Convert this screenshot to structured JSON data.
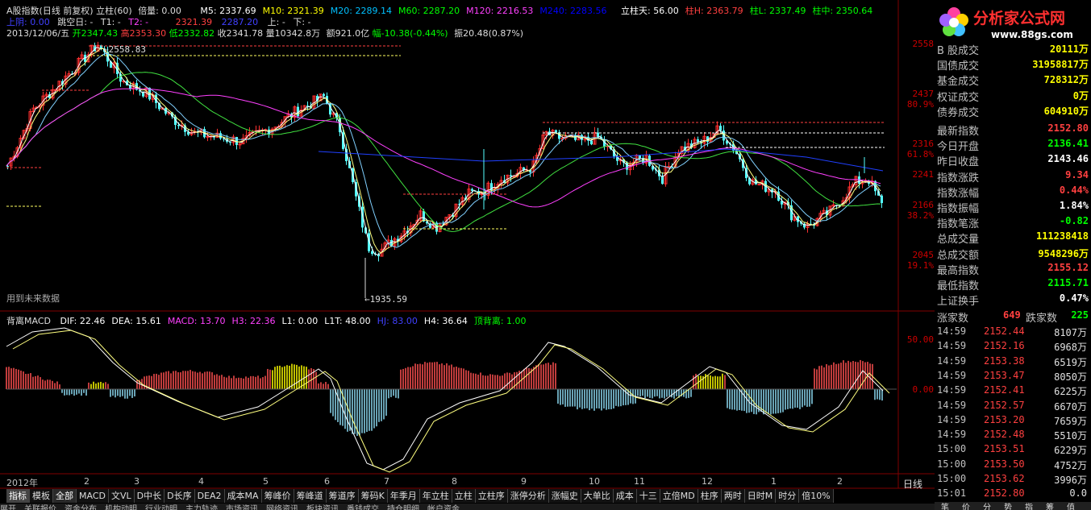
{
  "header": {
    "title": "A股指数(日线 前复权) 立柱(60)",
    "beiliang": "倍量: 0.00",
    "ma": [
      {
        "label": "M5: 2337.69",
        "color": "#ffffff"
      },
      {
        "label": "M10: 2321.39",
        "color": "#ffff00"
      },
      {
        "label": "M20: 2289.14",
        "color": "#00c0ff"
      },
      {
        "label": "M60: 2287.20",
        "color": "#00ff00"
      },
      {
        "label": "M120: 2216.53",
        "color": "#ff40ff"
      },
      {
        "label": "M240: 2283.56",
        "color": "#0000ff"
      }
    ],
    "lizhu": [
      {
        "label": "立柱天: 56.00",
        "color": "#ffffff"
      },
      {
        "label": "柱H: 2363.79",
        "color": "#ff4040"
      },
      {
        "label": "柱L: 2337.49",
        "color": "#00ff00"
      },
      {
        "label": "柱中: 2350.64",
        "color": "#00ff00"
      }
    ],
    "line2": {
      "shangyin": "上阴: 0.00",
      "tiaokong": "跳空日: -",
      "t1": "T1: -",
      "t2": "T2: -",
      "v1": "2321.39",
      "v2": "2287.20",
      "shang": "上: -",
      "xia": "下: -"
    },
    "line3": {
      "date": "2013/12/06/五",
      "kai": "开2347.43",
      "gao": "高2353.30",
      "di": "低2332.82",
      "shou": "收2341.78",
      "liang": "量10342.8万",
      "e": "额921.0亿",
      "fu": "幅-10.38(-0.44%)",
      "zhen": "振20.48(0.87%)"
    }
  },
  "price_panel": {
    "price_axis": [
      {
        "label": "2558",
        "pct": ""
      },
      {
        "label": "2437",
        "pct": "80.9%"
      },
      {
        "label": "2316",
        "pct": "61.8%"
      },
      {
        "label": "2241",
        "pct": ""
      },
      {
        "label": "2166",
        "pct": "38.2%"
      },
      {
        "label": "2045",
        "pct": "19.1%"
      }
    ],
    "high_label": "2558.83",
    "low_label": "1935.59",
    "future_note": "用到未来数据"
  },
  "macd_panel": {
    "title": "背离MACD",
    "items": [
      {
        "label": "DIF: 22.46",
        "color": "#ffffff"
      },
      {
        "label": "DEA: 15.61",
        "color": "#ffffff"
      },
      {
        "label": "MACD: 13.70",
        "color": "#ff40ff"
      },
      {
        "label": "H3: 22.36",
        "color": "#ff40ff"
      },
      {
        "label": "L1: 0.00",
        "color": "#ffffff"
      },
      {
        "label": "L1T: 48.00",
        "color": "#ffffff"
      },
      {
        "label": "HJ: 83.00",
        "color": "#4040ff"
      },
      {
        "label": "H4: 36.64",
        "color": "#ffffff"
      },
      {
        "label": "顶背离: 1.00",
        "color": "#00ff00"
      }
    ],
    "axis": [
      "50.00",
      "0.00"
    ]
  },
  "date_axis": [
    "2012年",
    "2",
    "3",
    "4",
    "5",
    "6",
    "7",
    "8",
    "9",
    "10",
    "11",
    "12",
    "1",
    "2"
  ],
  "period_label": "日线",
  "tabs": [
    "指标",
    "模板",
    "全部",
    "MACD",
    "文VL",
    "D中长",
    "D长序",
    "DEA2",
    "成本MA",
    "筹峰价",
    "筹峰道",
    "筹道序",
    "筹码K",
    "年季月",
    "年立柱",
    "立柱",
    "立柱序",
    "涨停分析",
    "涨幅史",
    "大单比",
    "成本",
    "十三",
    "立倍MD",
    "柱序",
    "两时",
    "日时M",
    "时分",
    "倍10%"
  ],
  "bottom_tabs": [
    "展开",
    "关联报价",
    "资金分布",
    "机构动明",
    "行业动明",
    "主力轨迹",
    "市场资讯",
    "网络资讯",
    "板块资讯",
    "番钱成交",
    "持仓明细",
    "帐户资金"
  ],
  "right_panel": {
    "logo_text": "分析家公式网",
    "logo_url": "www.88gs.com",
    "stats": [
      {
        "label": "B 股成交",
        "value": "20111万",
        "color": "#ffff00"
      },
      {
        "label": "国债成交",
        "value": "31958817万",
        "color": "#ffff00"
      },
      {
        "label": "基金成交",
        "value": "728312万",
        "color": "#ffff00"
      },
      {
        "label": "权证成交",
        "value": "0万",
        "color": "#ffff00"
      },
      {
        "label": "债券成交",
        "value": "604910万",
        "color": "#ffff00"
      },
      {
        "label": "最新指数",
        "value": "2152.80",
        "color": "#ff4040"
      },
      {
        "label": "今日开盘",
        "value": "2136.41",
        "color": "#00ff00"
      },
      {
        "label": "昨日收盘",
        "value": "2143.46",
        "color": "#ffffff"
      },
      {
        "label": "指数涨跌",
        "value": "9.34",
        "color": "#ff4040"
      },
      {
        "label": "指数涨幅",
        "value": "0.44%",
        "color": "#ff4040"
      },
      {
        "label": "指数振幅",
        "value": "1.84%",
        "color": "#ffffff"
      },
      {
        "label": "指数笔涨",
        "value": "-0.82",
        "color": "#00ff00"
      },
      {
        "label": "总成交量",
        "value": "111238418",
        "color": "#ffff00"
      },
      {
        "label": "总成交额",
        "value": "9548296万",
        "color": "#ffff00"
      },
      {
        "label": "最高指数",
        "value": "2155.12",
        "color": "#ff4040"
      },
      {
        "label": "最低指数",
        "value": "2115.71",
        "color": "#00ff00"
      },
      {
        "label": "上证换手",
        "value": "0.47%",
        "color": "#ffffff"
      }
    ],
    "updown": {
      "up_label": "涨家数",
      "up_value": "649",
      "down_label": "跌家数",
      "down_value": "225"
    },
    "ticks": [
      {
        "time": "14:59",
        "price": "2152.44",
        "vol": "8107万"
      },
      {
        "time": "14:59",
        "price": "2152.16",
        "vol": "6968万"
      },
      {
        "time": "14:59",
        "price": "2153.38",
        "vol": "6519万"
      },
      {
        "time": "14:59",
        "price": "2153.47",
        "vol": "8050万"
      },
      {
        "time": "14:59",
        "price": "2152.41",
        "vol": "6225万"
      },
      {
        "time": "14:59",
        "price": "2152.57",
        "vol": "6670万"
      },
      {
        "time": "14:59",
        "price": "2153.20",
        "vol": "7659万"
      },
      {
        "time": "14:59",
        "price": "2152.48",
        "vol": "5510万"
      },
      {
        "time": "15:00",
        "price": "2153.51",
        "vol": "6229万"
      },
      {
        "time": "15:00",
        "price": "2153.50",
        "vol": "4752万"
      },
      {
        "time": "15:00",
        "price": "2153.62",
        "vol": "3996万"
      },
      {
        "time": "15:01",
        "price": "2152.80",
        "vol": "0.0"
      }
    ],
    "bottom_icons": [
      "笔",
      "价",
      "分",
      "势",
      "指",
      "筹",
      "值"
    ]
  }
}
